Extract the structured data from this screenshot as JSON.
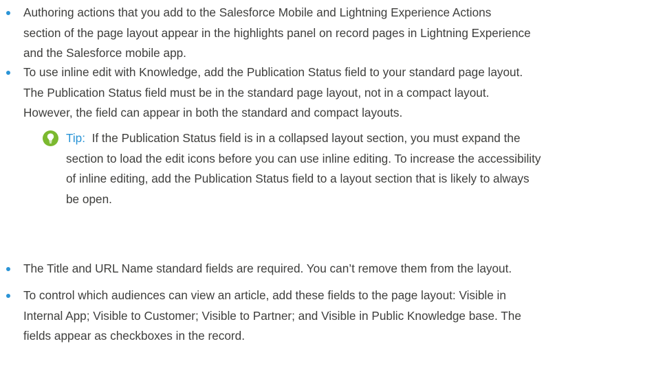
{
  "bullet_color": "#2a94d6",
  "tip_accent_color": "#2a94d6",
  "tip_icon_color": "#7bb92f",
  "tip_icon": "lightbulb-icon",
  "items": [
    {
      "lines": [
        "Authoring actions that you add to the Salesforce Mobile and Lightning Experience Actions",
        "section of the page layout appear in the highlights panel on record pages in Lightning Experience",
        "and the Salesforce mobile app."
      ]
    },
    {
      "lines": [
        "To use inline edit with Knowledge, add the Publication Status field to your standard page layout.",
        "The Publication Status field must be in the standard page layout, not in a compact layout.",
        "However, the field can appear in both the standard and compact layouts."
      ]
    },
    {
      "lines": [
        "The Title and URL Name standard fields are required. You can’t remove them from the layout."
      ]
    },
    {
      "lines": [
        "To control which audiences can view an article, add these fields to the page layout: Visible in",
        "Internal App; Visible to Customer; Visible to Partner; and Visible in Public Knowledge base. The",
        "fields appear as checkboxes in the record."
      ]
    }
  ],
  "tip": {
    "label": "Tip:",
    "first_line": "If the Publication Status field is in a collapsed layout section, you must expand the",
    "lines": [
      "section to load the edit icons before you can use inline editing. To increase the accessibility",
      "of inline editing, add the Publication Status field to a layout section that is likely to always",
      "be open."
    ]
  }
}
